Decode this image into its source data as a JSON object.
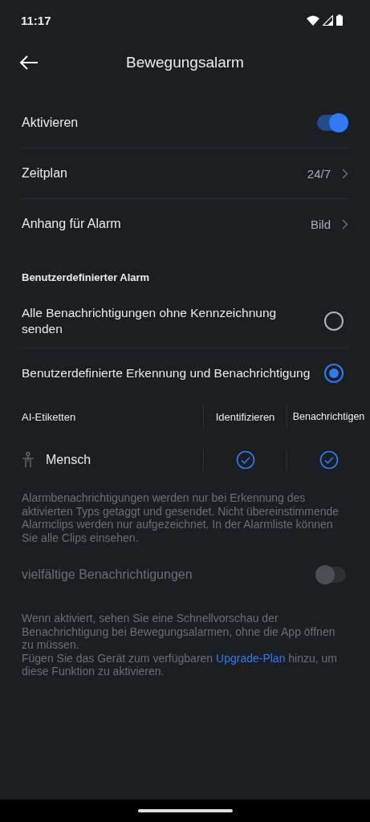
{
  "status_bar": {
    "time": "11:17"
  },
  "header": {
    "title": "Bewegungsalarm"
  },
  "settings": [
    {
      "kind": "toggle",
      "label": "Aktivieren",
      "on": true
    },
    {
      "kind": "link",
      "label": "Zeitplan",
      "value": "24/7"
    },
    {
      "kind": "link",
      "label": "Anhang für Alarm",
      "value": "Bild"
    }
  ],
  "custom_alarm": {
    "title": "Benutzerdefinierter Alarm",
    "options": [
      {
        "label": "Alle Benachrichtigungen ohne Kennzeichnung senden",
        "selected": false
      },
      {
        "label": "Benutzerdefinierte Erkennung und Benachrichtigung",
        "selected": true
      }
    ]
  },
  "ai_table": {
    "columns": [
      "AI-Etiketten",
      "Identifizieren",
      "Benachrichtigen"
    ],
    "rows": [
      {
        "label": "Mensch",
        "identify": true,
        "notify": true
      }
    ]
  },
  "info_text": "Alarmbenachrichtigungen werden nur bei Erkennung des aktivierten Typs getaggt und gesendet. Nicht übereinstimmende Alarmclips werden nur aufgezeichnet. In der Alarmliste können Sie alle Clips einsehen.",
  "rich_notifications": {
    "label": "vielfältige Benachrichtigungen",
    "on": false,
    "disabled": true
  },
  "footer": {
    "text": "Wenn aktiviert, sehen Sie eine Schnellvorschau der Benachrichtigung bei Bewegungsalarmen, ohne die App öffnen zu müssen.",
    "upgrade_before": "Fügen Sie das Gerät zum verfügbaren",
    "upgrade_link": "Upgrade-Plan",
    "upgrade_after": "hinzu, um diese Funktion zu aktivieren."
  }
}
